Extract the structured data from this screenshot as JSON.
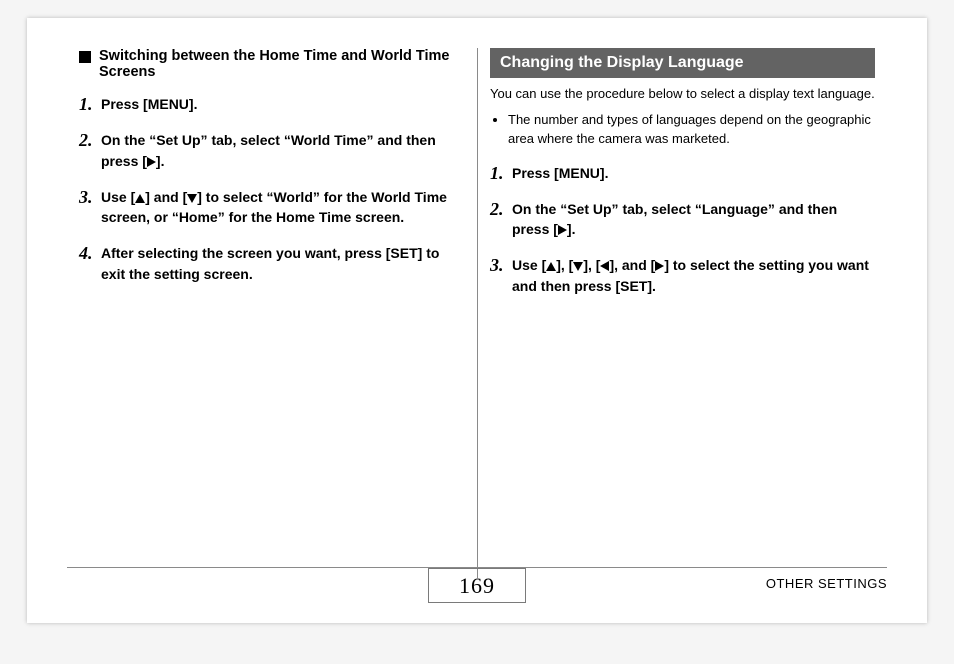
{
  "left": {
    "heading": "Switching between the Home Time and World Time Screens",
    "steps": [
      "Press [MENU].",
      "On the “Set Up” tab, select “World Time” and then press [▶].",
      "Use [▲] and [▼] to select “World” for the World Time screen, or “Home” for the Home Time screen.",
      "After selecting the screen you want, press [SET] to exit the setting screen."
    ]
  },
  "right": {
    "title": "Changing the Display Language",
    "intro": "You can use the procedure below to select a display text language.",
    "note": "The number and types of languages depend on the geographic area where the camera was marketed.",
    "steps": [
      "Press [MENU].",
      "On the “Set Up” tab, select “Language” and then press [▶].",
      "Use [▲], [▼], [◀], and [▶] to select the setting you want and then press [SET]."
    ]
  },
  "footer": "OTHER SETTINGS",
  "page_number": "169"
}
